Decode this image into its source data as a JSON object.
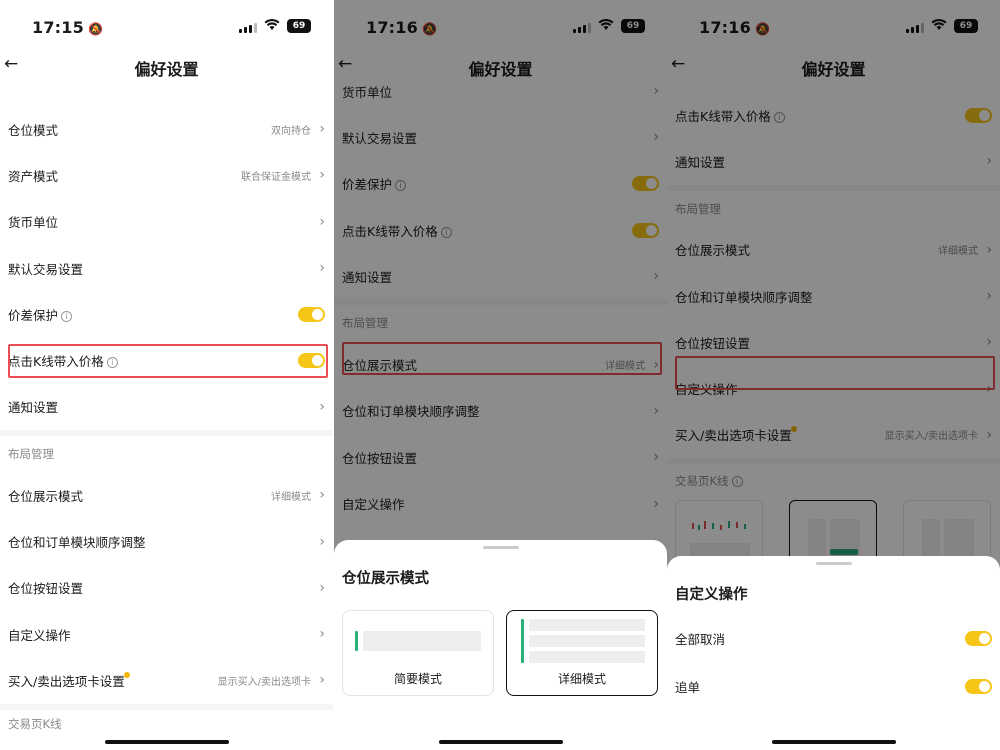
{
  "colors": {
    "accent": "#f5c518",
    "highlight": "#e94f55",
    "green": "#2cb07a"
  },
  "panels": [
    {
      "status": {
        "time": "17:15",
        "battery": "69"
      },
      "nav": {
        "back": "←",
        "title": "偏好设置"
      },
      "rows": [
        {
          "label": "仓位模式",
          "value": "双向持仓"
        },
        {
          "label": "资产模式",
          "value": "联合保证金模式"
        },
        {
          "label": "货币单位"
        },
        {
          "label": "默认交易设置"
        },
        {
          "label": "价差保护",
          "toggle": true
        },
        {
          "label": "点击K线带入价格",
          "toggle": true
        },
        {
          "label": "通知设置"
        }
      ],
      "section": "布局管理",
      "rows2": [
        {
          "label": "仓位展示模式",
          "value": "详细模式"
        },
        {
          "label": "仓位和订单模块顺序调整"
        },
        {
          "label": "仓位按钮设置"
        },
        {
          "label": "自定义操作"
        },
        {
          "label": "买入/卖出选项卡设置",
          "value": "显示买入/卖出选项卡"
        }
      ],
      "bottom_section": "交易页K线"
    },
    {
      "status": {
        "time": "17:16",
        "battery": "69"
      },
      "nav": {
        "back": "←",
        "title": "偏好设置"
      },
      "rows": [
        {
          "label": "货币单位"
        },
        {
          "label": "默认交易设置"
        },
        {
          "label": "价差保护",
          "toggle": true
        },
        {
          "label": "点击K线带入价格",
          "toggle": true
        },
        {
          "label": "通知设置"
        }
      ],
      "section": "布局管理",
      "rows2": [
        {
          "label": "仓位展示模式",
          "value": "详细模式"
        },
        {
          "label": "仓位和订单模块顺序调整"
        },
        {
          "label": "仓位按钮设置"
        },
        {
          "label": "自定义操作"
        }
      ],
      "sheet": {
        "title": "仓位展示模式",
        "options": [
          {
            "label": "简要模式"
          },
          {
            "label": "详细模式",
            "selected": true
          }
        ]
      }
    },
    {
      "status": {
        "time": "17:16",
        "battery": "69"
      },
      "nav": {
        "back": "←",
        "title": "偏好设置"
      },
      "rows": [
        {
          "label": "点击K线带入价格",
          "toggle": true
        },
        {
          "label": "通知设置"
        }
      ],
      "section": "布局管理",
      "rows2": [
        {
          "label": "仓位展示模式",
          "value": "详细模式"
        },
        {
          "label": "仓位和订单模块顺序调整"
        },
        {
          "label": "仓位按钮设置"
        },
        {
          "label": "自定义操作"
        },
        {
          "label": "买入/卖出选项卡设置",
          "value": "显示买入/卖出选项卡"
        }
      ],
      "kline_section": "交易页K线",
      "sheet": {
        "title": "自定义操作",
        "options": [
          {
            "label": "全部取消",
            "toggle": true
          },
          {
            "label": "追单",
            "toggle": true
          }
        ]
      }
    }
  ]
}
